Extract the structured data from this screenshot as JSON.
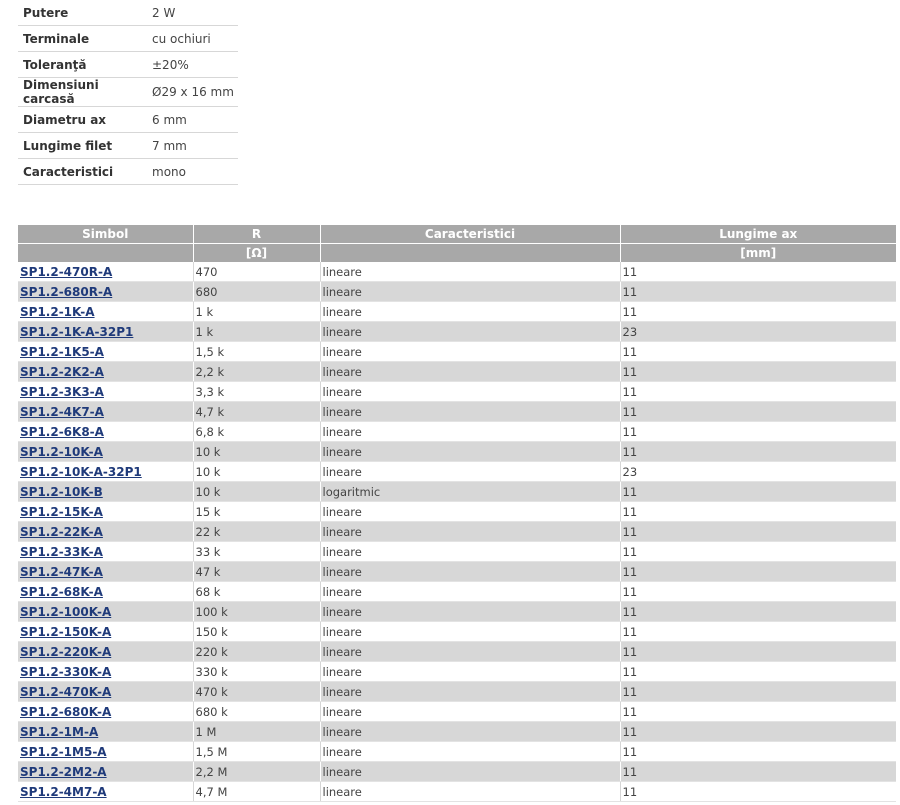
{
  "specs": [
    {
      "label": "Putere",
      "value": "2 W"
    },
    {
      "label": "Terminale",
      "value": "cu ochiuri"
    },
    {
      "label": "Toleranţă",
      "value": "±20%"
    },
    {
      "label": "Dimensiuni carcasă",
      "value": "Ø29 x 16 mm"
    },
    {
      "label": "Diametru ax",
      "value": "6 mm"
    },
    {
      "label": "Lungime filet",
      "value": "7 mm"
    },
    {
      "label": "Caracteristici",
      "value": "mono"
    }
  ],
  "table": {
    "headers": [
      "Simbol",
      "R",
      "Caracteristici",
      "Lungime ax"
    ],
    "units": [
      "",
      "[Ω]",
      "",
      "[mm]"
    ],
    "rows": [
      [
        "SP1.2-470R-A",
        "470",
        "lineare",
        "11"
      ],
      [
        "SP1.2-680R-A",
        "680",
        "lineare",
        "11"
      ],
      [
        "SP1.2-1K-A",
        "1 k",
        "lineare",
        "11"
      ],
      [
        "SP1.2-1K-A-32P1",
        "1 k",
        "lineare",
        "23"
      ],
      [
        "SP1.2-1K5-A",
        "1,5 k",
        "lineare",
        "11"
      ],
      [
        "SP1.2-2K2-A",
        "2,2 k",
        "lineare",
        "11"
      ],
      [
        "SP1.2-3K3-A",
        "3,3 k",
        "lineare",
        "11"
      ],
      [
        "SP1.2-4K7-A",
        "4,7 k",
        "lineare",
        "11"
      ],
      [
        "SP1.2-6K8-A",
        "6,8 k",
        "lineare",
        "11"
      ],
      [
        "SP1.2-10K-A",
        "10 k",
        "lineare",
        "11"
      ],
      [
        "SP1.2-10K-A-32P1",
        "10 k",
        "lineare",
        "23"
      ],
      [
        "SP1.2-10K-B",
        "10 k",
        "logaritmic",
        "11"
      ],
      [
        "SP1.2-15K-A",
        "15 k",
        "lineare",
        "11"
      ],
      [
        "SP1.2-22K-A",
        "22 k",
        "lineare",
        "11"
      ],
      [
        "SP1.2-33K-A",
        "33 k",
        "lineare",
        "11"
      ],
      [
        "SP1.2-47K-A",
        "47 k",
        "lineare",
        "11"
      ],
      [
        "SP1.2-68K-A",
        "68 k",
        "lineare",
        "11"
      ],
      [
        "SP1.2-100K-A",
        "100 k",
        "lineare",
        "11"
      ],
      [
        "SP1.2-150K-A",
        "150 k",
        "lineare",
        "11"
      ],
      [
        "SP1.2-220K-A",
        "220 k",
        "lineare",
        "11"
      ],
      [
        "SP1.2-330K-A",
        "330 k",
        "lineare",
        "11"
      ],
      [
        "SP1.2-470K-A",
        "470 k",
        "lineare",
        "11"
      ],
      [
        "SP1.2-680K-A",
        "680 k",
        "lineare",
        "11"
      ],
      [
        "SP1.2-1M-A",
        "1 M",
        "lineare",
        "11"
      ],
      [
        "SP1.2-1M5-A",
        "1,5 M",
        "lineare",
        "11"
      ],
      [
        "SP1.2-2M2-A",
        "2,2 M",
        "lineare",
        "11"
      ],
      [
        "SP1.2-4M7-A",
        "4,7 M",
        "lineare",
        "11"
      ]
    ]
  }
}
